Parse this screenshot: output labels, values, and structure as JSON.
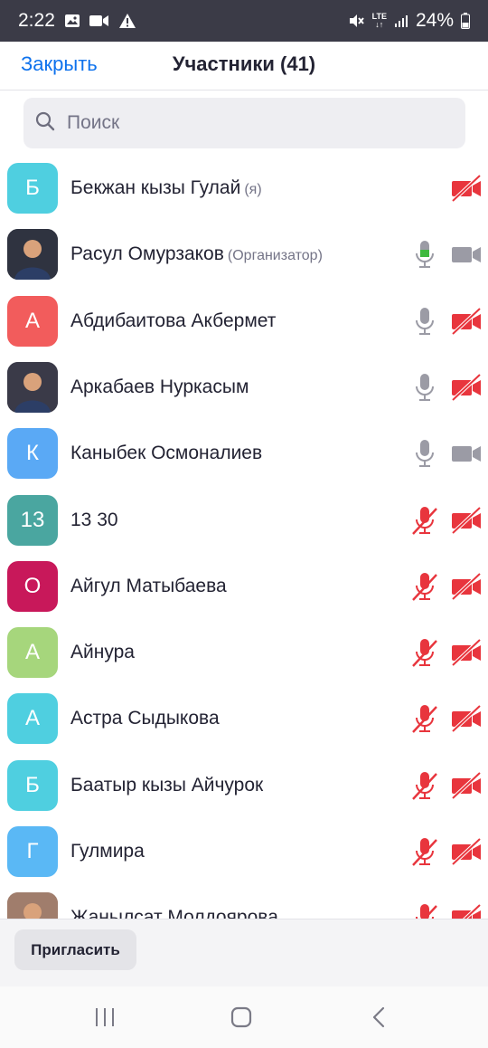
{
  "status_bar": {
    "time": "2:22",
    "lte": "LTE",
    "battery": "24%"
  },
  "header": {
    "close_label": "Закрыть",
    "title": "Участники (41)"
  },
  "search": {
    "placeholder": "Поиск"
  },
  "participants": [
    {
      "initial": "Б",
      "name": "Бекжан кызы Гулай",
      "role": "(я)",
      "avatar_color": "#4fcfe0",
      "photo": false,
      "mic": "none",
      "camera": "off"
    },
    {
      "initial": "",
      "name": "Расул Омурзаков",
      "role": "(Организатор)",
      "avatar_color": "#2f3340",
      "photo": true,
      "mic": "active",
      "camera": "on"
    },
    {
      "initial": "А",
      "name": "Абдибаитова Акбермет",
      "role": "",
      "avatar_color": "#f25c5c",
      "photo": false,
      "mic": "on",
      "camera": "off"
    },
    {
      "initial": "",
      "name": "Аркабаев Нуркасым",
      "role": "",
      "avatar_color": "#3a3a48",
      "photo": true,
      "mic": "on",
      "camera": "off"
    },
    {
      "initial": "К",
      "name": "Каныбек Осмоналиев",
      "role": "",
      "avatar_color": "#5aa9f5",
      "photo": false,
      "mic": "on",
      "camera": "on"
    },
    {
      "initial": "13",
      "name": "13 30",
      "role": "",
      "avatar_color": "#4aa6a0",
      "photo": false,
      "mic": "muted",
      "camera": "off"
    },
    {
      "initial": "О",
      "name": "Айгул Матыбаева",
      "role": "",
      "avatar_color": "#c8185a",
      "photo": false,
      "mic": "muted",
      "camera": "off"
    },
    {
      "initial": "А",
      "name": "Айнура",
      "role": "",
      "avatar_color": "#a6d67c",
      "photo": false,
      "mic": "muted",
      "camera": "off"
    },
    {
      "initial": "А",
      "name": "Астра Сыдыкова",
      "role": "",
      "avatar_color": "#4fcfe0",
      "photo": false,
      "mic": "muted",
      "camera": "off"
    },
    {
      "initial": "Б",
      "name": "Баатыр кызы Айчурок",
      "role": "",
      "avatar_color": "#4fcfe0",
      "photo": false,
      "mic": "muted",
      "camera": "off"
    },
    {
      "initial": "Г",
      "name": "Гулмира",
      "role": "",
      "avatar_color": "#5ab8f5",
      "photo": false,
      "mic": "muted",
      "camera": "off"
    },
    {
      "initial": "",
      "name": "Жанылсат Молдоярова",
      "role": "",
      "avatar_color": "#a07d6c",
      "photo": true,
      "mic": "muted",
      "camera": "off"
    }
  ],
  "footer": {
    "invite_label": "Пригласить"
  },
  "colors": {
    "accent": "#0e72ed",
    "muted_red": "#e8353d",
    "active_green": "#3fb93f",
    "icon_gray": "#9b9ba5"
  }
}
